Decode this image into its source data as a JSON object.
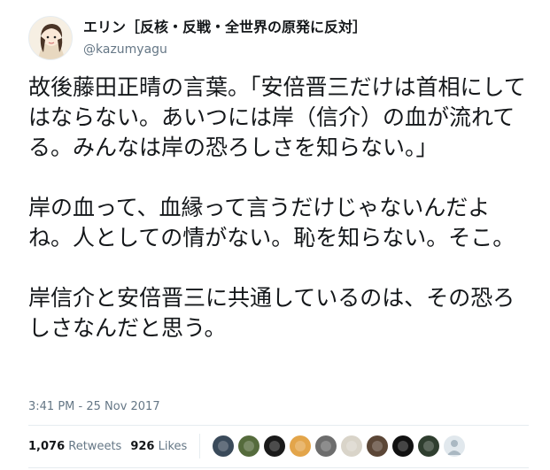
{
  "user": {
    "display_name": "エリン［反核・反戦・全世界の原発に反対］",
    "handle": "@kazumyagu"
  },
  "tweet": {
    "paragraphs": [
      "故後藤田正晴の言葉。「安倍晋三だけは首相にしてはならない。あいつには岸（信介）の血が流れてる。みんなは岸の恐ろしさを知らない。」",
      "岸の血って、血縁って言うだけじゃないんだよね。人としての情がない。恥を知らない。そこ。",
      "岸信介と安倍晋三に共通しているのは、その恐ろしさなんだと思う。"
    ],
    "timestamp": "3:41 PM - 25 Nov 2017"
  },
  "stats": {
    "retweets_count": "1,076",
    "retweets_label": "Retweets",
    "likes_count": "926",
    "likes_label": "Likes"
  },
  "likers": [
    {
      "icon": "liker-avatar",
      "color": "#3a4a5a"
    },
    {
      "icon": "liker-avatar",
      "color": "#556b3c"
    },
    {
      "icon": "liker-avatar",
      "color": "#1a1a1a"
    },
    {
      "icon": "liker-avatar",
      "color": "#e3a54a"
    },
    {
      "icon": "liker-avatar",
      "color": "#6d6d6d"
    },
    {
      "icon": "liker-avatar",
      "color": "#d9d4c9"
    },
    {
      "icon": "liker-avatar",
      "color": "#5b4636"
    },
    {
      "icon": "liker-avatar",
      "color": "#111111"
    },
    {
      "icon": "liker-avatar",
      "color": "#2f3e2f"
    },
    {
      "icon": "default-avatar",
      "color": "#aab8c2"
    }
  ]
}
